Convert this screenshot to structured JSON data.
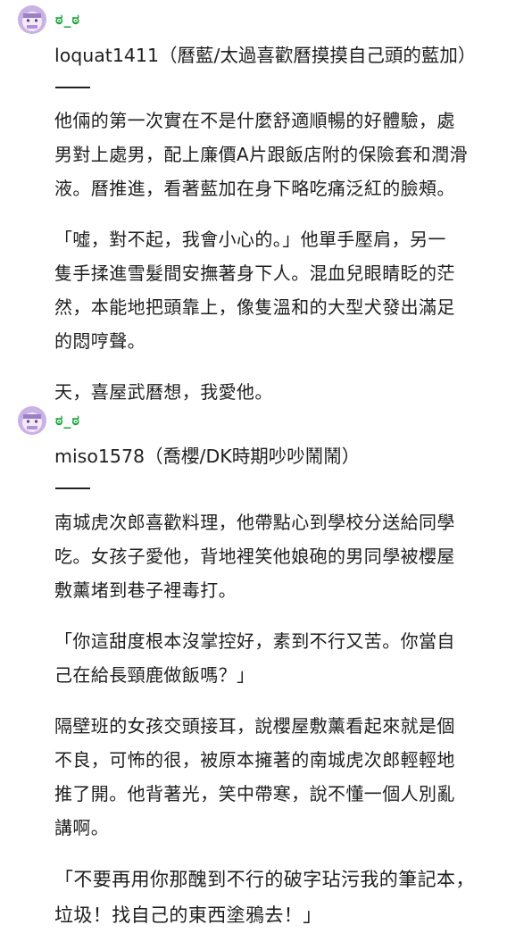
{
  "accent": "#1aa33a",
  "avatar_color": "#c9b3e6",
  "posts": [
    {
      "handle": "ಠ_ಠ",
      "author": "loquat1411（曆藍/太過喜歡曆摸摸自己頭的藍加）",
      "paragraphs": [
        [
          "他倆的第一次實在不是什麼舒適順暢的好體驗，處",
          "男對上處男，配上廉價A片跟飯店附的保險套和潤滑",
          "液。曆推進，看著藍加在身下略吃痛泛紅的臉頰。"
        ],
        [
          "「噓，對不起，我會小心的。」他單手壓肩，另一",
          "隻手揉進雪髮間安撫著身下人。混血兒眼睛眨的茫",
          "然，本能地把頭靠上，像隻溫和的大型犬發出滿足",
          "的悶哼聲。"
        ],
        [
          "天，喜屋武曆想，我愛他。"
        ]
      ]
    },
    {
      "handle": "ಠ_ಠ",
      "author": "miso1578（喬櫻/DK時期吵吵鬧鬧）",
      "paragraphs": [
        [
          "南城虎次郎喜歡料理，他帶點心到學校分送給同學",
          "吃。女孩子愛他，背地裡笑他娘砲的男同學被櫻屋",
          "敷薰堵到巷子裡毒打。"
        ],
        [
          "「你這甜度根本沒掌控好，素到不行又苦。你當自",
          "己在給長頸鹿做飯嗎？」"
        ],
        [
          "隔壁班的女孩交頭接耳，說櫻屋敷薰看起來就是個",
          "不良，可怖的很，被原本擁著的南城虎次郎輕輕地",
          "推了開。他背著光，笑中帶寒，說不懂一個人別亂",
          "講啊。"
        ],
        [
          "「不要再用你那醜到不行的破字玷污我的筆記本，",
          "垃圾！找自己的東西塗鴉去！」"
        ]
      ]
    }
  ]
}
